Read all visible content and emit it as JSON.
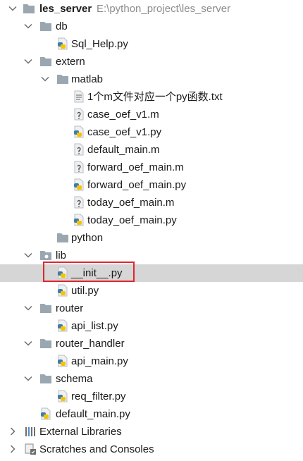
{
  "project": {
    "name": "les_server",
    "path": "E:\\python_project\\les_server"
  },
  "tree": [
    {
      "label": "db",
      "type": "folder",
      "depth": 1,
      "expanded": true
    },
    {
      "label": "Sql_Help.py",
      "type": "py",
      "depth": 2
    },
    {
      "label": "extern",
      "type": "folder",
      "depth": 1,
      "expanded": true
    },
    {
      "label": "matlab",
      "type": "folder",
      "depth": 2,
      "expanded": true
    },
    {
      "label": "1个m文件对应一个py函数.txt",
      "type": "txt",
      "depth": 3
    },
    {
      "label": "case_oef_v1.m",
      "type": "m",
      "depth": 3
    },
    {
      "label": "case_oef_v1.py",
      "type": "py",
      "depth": 3
    },
    {
      "label": "default_main.m",
      "type": "m",
      "depth": 3
    },
    {
      "label": "forward_oef_main.m",
      "type": "m",
      "depth": 3
    },
    {
      "label": "forward_oef_main.py",
      "type": "py",
      "depth": 3
    },
    {
      "label": "today_oef_main.m",
      "type": "m",
      "depth": 3
    },
    {
      "label": "today_oef_main.py",
      "type": "py",
      "depth": 3
    },
    {
      "label": "python",
      "type": "folder",
      "depth": 2
    },
    {
      "label": "lib",
      "type": "package",
      "depth": 1,
      "expanded": true
    },
    {
      "label": "__init__.py",
      "type": "py",
      "depth": 2,
      "selected": true
    },
    {
      "label": "util.py",
      "type": "py",
      "depth": 2
    },
    {
      "label": "router",
      "type": "folder",
      "depth": 1,
      "expanded": true
    },
    {
      "label": "api_list.py",
      "type": "py",
      "depth": 2
    },
    {
      "label": "router_handler",
      "type": "folder",
      "depth": 1,
      "expanded": true
    },
    {
      "label": "api_main.py",
      "type": "py",
      "depth": 2
    },
    {
      "label": "schema",
      "type": "folder",
      "depth": 1,
      "expanded": true
    },
    {
      "label": "req_filter.py",
      "type": "py",
      "depth": 2
    },
    {
      "label": "default_main.py",
      "type": "py",
      "depth": 1
    },
    {
      "label": "External Libraries",
      "type": "libraries",
      "depth": 0,
      "expanded": false
    },
    {
      "label": "Scratches and Consoles",
      "type": "scratches",
      "depth": 0,
      "expanded": false
    }
  ],
  "colors": {
    "folder": "#9aa7b0",
    "selection": "#d6d6d6",
    "highlight_border": "#e0262b",
    "python_blue": "#3f7cac",
    "python_yellow": "#f5c400",
    "path_text": "#8c8c8c"
  }
}
